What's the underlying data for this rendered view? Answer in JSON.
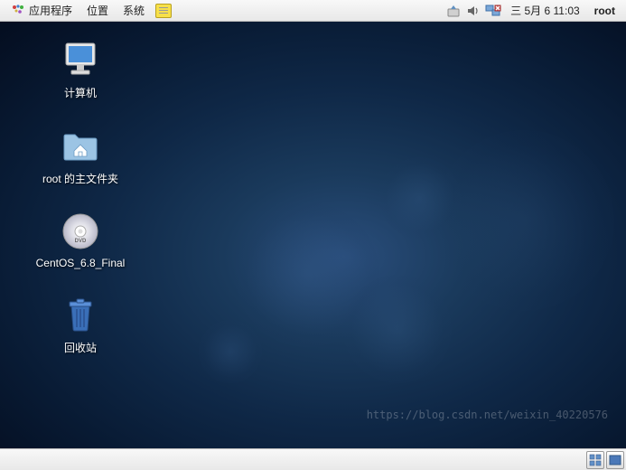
{
  "top_panel": {
    "menus": {
      "applications": "应用程序",
      "places": "位置",
      "system": "系统"
    },
    "clock": "三 5月  6 11:03",
    "user": "root"
  },
  "desktop_icons": {
    "computer": "计算机",
    "home_folder": "root 的主文件夹",
    "dvd": "CentOS_6.8_Final",
    "trash": "回收站"
  },
  "watermark": "https://blog.csdn.net/weixin_40220576"
}
